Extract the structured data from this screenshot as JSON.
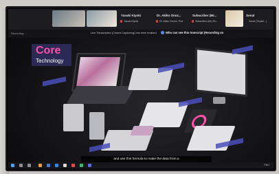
{
  "meeting": {
    "participants": [
      {
        "name": "Yasuki Kiyoki",
        "sub": "Yasuki Kiyoki"
      },
      {
        "name": "Dr. Akiko Onoz...",
        "sub": "Dr. Akiko Onoze, Prof"
      },
      {
        "name": "Subscriber (Mr...",
        "sub": "Subscriber (Mr) Ru..."
      },
      {
        "name": "Sonal",
        "sub": "Sonal (Tiryaki...)"
      }
    ],
    "recording_label": "Recording...",
    "notice": "Live Transcription (Closed Captioning) has been enabled.",
    "notice_alert": "Who can see this transcript (Recording on"
  },
  "slide": {
    "logo_top": "Core",
    "logo_bottom": "Technology"
  },
  "caption": "and use this formula to make the data from a",
  "taskbar": {
    "tray": "ENG"
  },
  "colors": {
    "accent_pink": "#ff4fa8",
    "tag_purple": "#4b4fb8"
  }
}
